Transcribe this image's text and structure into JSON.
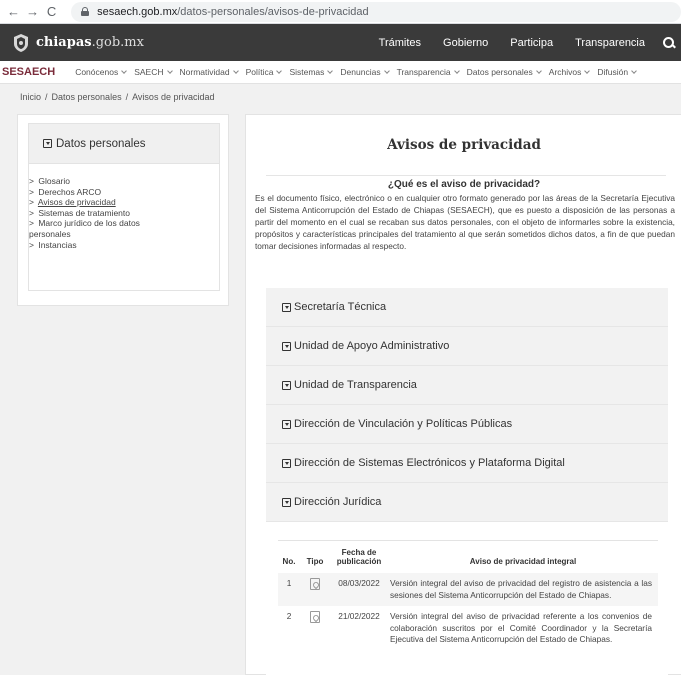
{
  "browser": {
    "back": "←",
    "forward": "→",
    "reload": "C",
    "url_host": "sesaech.gob.mx",
    "url_path": "/datos-personales/avisos-de-privacidad"
  },
  "topbar": {
    "logo_bold": "chiapas",
    "logo_rest": ".gob.mx",
    "links": [
      "Trámites",
      "Gobierno",
      "Participa",
      "Transparencia"
    ]
  },
  "subnav": {
    "brand": "SESAECH",
    "items": [
      "Conócenos",
      "SAECH",
      "Normatividad",
      "Política",
      "Sistemas",
      "Denuncias",
      "Transparencia",
      "Datos personales",
      "Archivos",
      "Difusión"
    ]
  },
  "breadcrumb": {
    "items": [
      "Inicio",
      "Datos personales",
      "Avisos de privacidad"
    ],
    "separator": "/"
  },
  "sidebar": {
    "title": "Datos personales",
    "items": [
      {
        "label": "Glosario"
      },
      {
        "label": "Derechos ARCO"
      },
      {
        "label": "Avisos de privacidad"
      },
      {
        "label": "Sistemas de tratamiento"
      },
      {
        "label": "Marco jurídico de los datos"
      },
      {
        "label": "personales"
      },
      {
        "label": "Instancias"
      }
    ]
  },
  "main": {
    "title": "Avisos de privacidad",
    "question": "¿Qué es el aviso de privacidad?",
    "intro": "Es el documento físico, electrónico o en cualquier otro formato generado por las áreas de la Secretaría Ejecutiva del Sistema Anticorrupción del Estado de Chiapas (SESAECH), que es puesto a disposición de las personas a partir del momento en el cual se recaban sus datos personales, con el objeto de informarles sobre la existencia, propósitos y características principales del tratamiento al que serán sometidos dichos datos, a fin de que puedan tomar decisiones informadas al respecto.",
    "sections": [
      "Secretaría Técnica",
      "Unidad de Apoyo Administrativo",
      "Unidad de Transparencia",
      "Dirección de Vinculación y Políticas Públicas",
      "Dirección de Sistemas Electrónicos y Plataforma Digital",
      "Dirección Jurídica"
    ],
    "table": {
      "headers": {
        "no": "No.",
        "tipo": "Tipo",
        "fecha_line1": "Fecha de",
        "fecha_line2": "publicación",
        "aviso": "Aviso de privacidad integral"
      },
      "rows": [
        {
          "no": "1",
          "fecha": "08/03/2022",
          "desc": "Versión integral del aviso de privacidad del registro de asistencia a las sesiones del Sistema Anticorrupción del Estado de Chiapas."
        },
        {
          "no": "2",
          "fecha": "21/02/2022",
          "desc": "Versión integral del aviso de privacidad referente a los convenios de colaboración suscritos por el Comité Coordinador y la Secretaría Ejecutiva del Sistema Anticorrupción del Estado de Chiapas."
        }
      ]
    }
  },
  "colors": {
    "topbar": "#3a3a3a",
    "brand": "#7a2b3a",
    "panel": "#f2f2f2"
  }
}
